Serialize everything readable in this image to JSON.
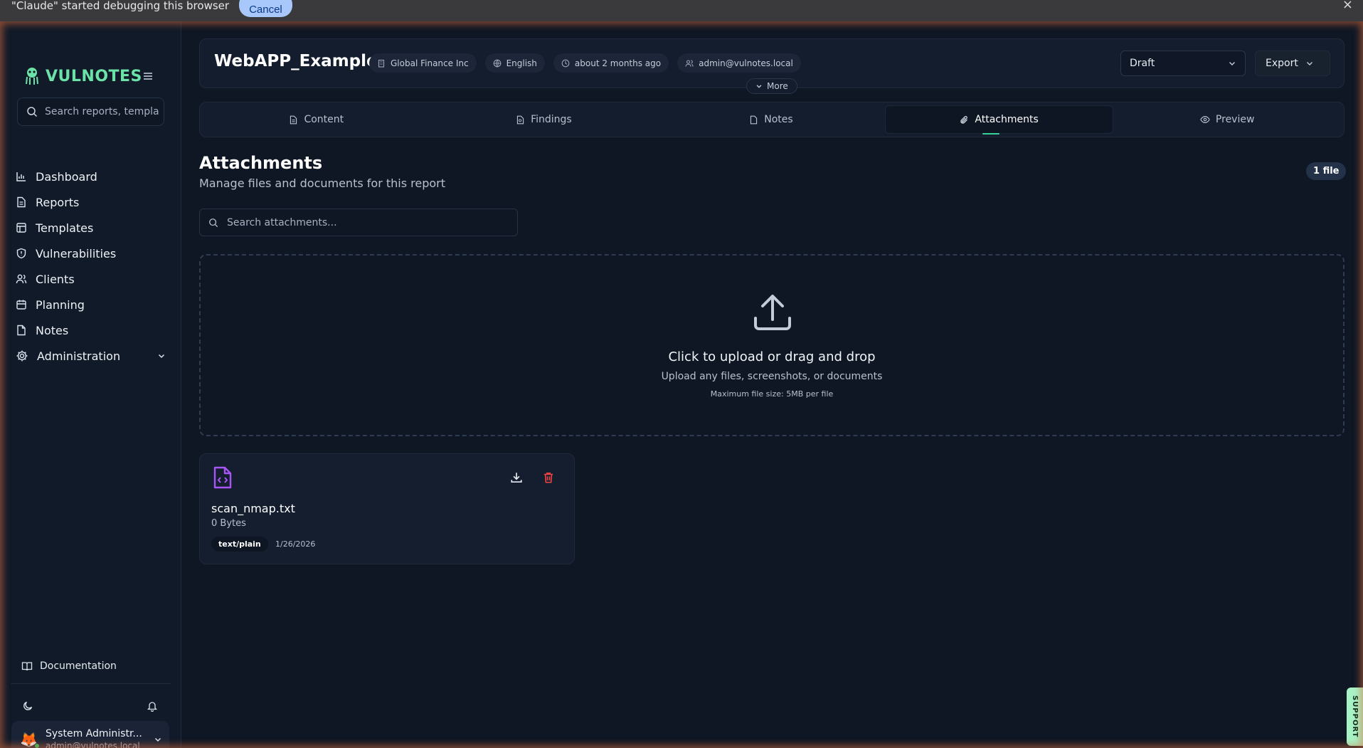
{
  "debug_bar": {
    "message": "\"Claude\" started debugging this browser",
    "cancel_label": "Cancel",
    "close_glyph": "×"
  },
  "brand": {
    "name": "VULNOTES"
  },
  "sidebar": {
    "search_placeholder": "Search reports, templat",
    "items": [
      {
        "label": "Dashboard",
        "icon": "bar-chart-icon"
      },
      {
        "label": "Reports",
        "icon": "file-text-icon"
      },
      {
        "label": "Templates",
        "icon": "layout-icon"
      },
      {
        "label": "Vulnerabilities",
        "icon": "shield-icon"
      },
      {
        "label": "Clients",
        "icon": "users-icon"
      },
      {
        "label": "Planning",
        "icon": "calendar-icon"
      },
      {
        "label": "Notes",
        "icon": "note-icon"
      },
      {
        "label": "Administration",
        "icon": "gear-icon"
      }
    ],
    "documentation_label": "Documentation",
    "user": {
      "name": "System Administr...",
      "email": "admin@vulnotes.local"
    }
  },
  "header": {
    "title": "WebAPP_Example",
    "chips": {
      "client": "Global Finance Inc",
      "language": "English",
      "updated": "about 2 months ago",
      "owner": "admin@vulnotes.local"
    },
    "status_value": "Draft",
    "export_label": "Export",
    "more_label": "More"
  },
  "tabs": [
    {
      "label": "Content",
      "active": false
    },
    {
      "label": "Findings",
      "active": false
    },
    {
      "label": "Notes",
      "active": false
    },
    {
      "label": "Attachments",
      "active": true
    },
    {
      "label": "Preview",
      "active": false
    }
  ],
  "attachments": {
    "title": "Attachments",
    "subtitle": "Manage files and documents for this report",
    "count_badge": "1 file",
    "search_placeholder": "Search attachments...",
    "dropzone": {
      "title": "Click to upload or drag and drop",
      "subtitle": "Upload any files, screenshots, or documents",
      "max_size": "Maximum file size: 5MB per file"
    },
    "files": [
      {
        "name": "scan_nmap.txt",
        "size": "0 Bytes",
        "mime": "text/plain",
        "date": "1/26/2026"
      }
    ]
  },
  "support_label": "SUPPORT",
  "colors": {
    "accent": "#34d399",
    "brand": "#6be3a8",
    "file_icon": "#a855f7",
    "danger": "#ef4444"
  }
}
